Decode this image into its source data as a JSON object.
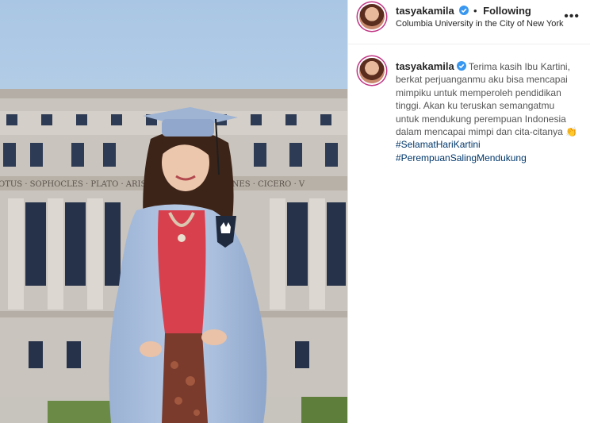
{
  "post": {
    "username": "tasyakamila",
    "follow_separator": "•",
    "follow_status": "Following",
    "location": "Columbia University in the City of New York",
    "more_label": "•••",
    "caption_text": "Terima kasih Ibu Kartini, berkat perjuanganmu aku bisa mencapai mimpiku untuk memperoleh pendidikan tinggi. Akan ku teruskan semangatmu untuk mendukung perempuan Indonesia dalam mencapai mimpi dan cita-citanya",
    "caption_emoji": "👏",
    "hashtags": [
      "#SelamatHariKartini",
      "#PerempuanSalingMendukung"
    ],
    "building_inscription": "OTUS · SOPHOCLES · PLATO · ARISTOTLE · DEMOSTHENES · CICERO · V",
    "colors": {
      "accent_link": "#00376b",
      "verified": "#3897f0",
      "sky": "#b9d2ea",
      "gown": "#8fa9cf"
    }
  }
}
